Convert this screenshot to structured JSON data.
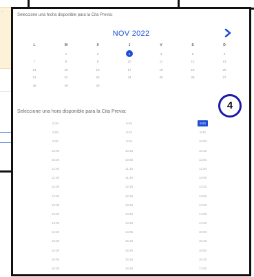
{
  "background": {
    "note_text": "...",
    "field_value": ""
  },
  "calendar": {
    "prompt": "Seleccione una fecha disponible para la Cita Previa:",
    "month_label": "NOV 2022",
    "weekday_headers": [
      "L",
      "M",
      "X",
      "J",
      "V",
      "S",
      "D"
    ],
    "weeks": [
      [
        "",
        "1",
        "2",
        "3",
        "4",
        "5",
        "6"
      ],
      [
        "7",
        "8",
        "9",
        "10",
        "11",
        "12",
        "13"
      ],
      [
        "14",
        "15",
        "16",
        "17",
        "18",
        "19",
        "20"
      ],
      [
        "21",
        "22",
        "23",
        "24",
        "25",
        "26",
        "27"
      ],
      [
        "28",
        "29",
        "30",
        "",
        "",
        "",
        ""
      ]
    ],
    "selected_day": "3",
    "accent_color": "#1e4ed8"
  },
  "badge": {
    "label": "4"
  },
  "time_slots": {
    "prompt": "Seleccione una hora disponible para la Cita Previa:",
    "rows": [
      [
        "8:30",
        "8:45",
        "9:00"
      ],
      [
        "9:00",
        "9:15",
        "9:30"
      ],
      [
        "9:30",
        "9:45",
        "10:00"
      ],
      [
        "10:00",
        "10:15",
        "10:30"
      ],
      [
        "10:30",
        "10:45",
        "11:00"
      ],
      [
        "11:00",
        "11:15",
        "11:30"
      ],
      [
        "11:30",
        "11:45",
        "12:00"
      ],
      [
        "12:00",
        "12:15",
        "12:30"
      ],
      [
        "12:30",
        "12:45",
        "13:00"
      ],
      [
        "13:00",
        "13:15",
        "13:30"
      ],
      [
        "13:30",
        "13:45",
        "14:00"
      ],
      [
        "14:00",
        "14:15",
        "14:30"
      ],
      [
        "14:30",
        "14:45",
        "15:00"
      ],
      [
        "15:00",
        "15:15",
        "15:30"
      ],
      [
        "15:30",
        "15:45",
        "16:00"
      ],
      [
        "16:00",
        "16:15",
        "16:30"
      ],
      [
        "16:30",
        "16:45",
        "17:00"
      ]
    ],
    "selected": "9:00"
  },
  "icons": {
    "next": "chevron-right-icon"
  }
}
